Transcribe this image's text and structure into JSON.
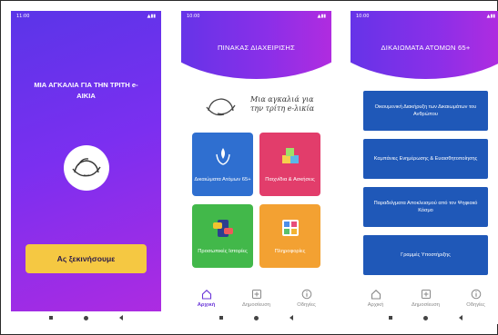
{
  "screen1": {
    "status_time": "11:00",
    "title": "ΜΙΑ ΑΓΚΑΛΙΑ ΓΙΑ ΤΗΝ ΤΡΙΤΗ e-ΑΙΚΙΑ",
    "start_button": "Ας ξεκινήσουμε"
  },
  "screen2": {
    "status_time": "10:00",
    "header_title": "ΠΙΝΑΚΑΣ ΔΙΑΧΕΙΡΙΣΗΣ",
    "logo_text_line1": "Μια αγκαλιά για",
    "logo_text_line2": "την τρίτη e-λικία",
    "tiles": [
      {
        "label": "Δικαιώματα Ατόμων 65+",
        "color": "#2f6fd0"
      },
      {
        "label": "Παιχνίδια & Ασκήσεις",
        "color": "#e23d6b"
      },
      {
        "label": "Προσωπικές Ιστορίες",
        "color": "#42b84a"
      },
      {
        "label": "Πληροφορίες",
        "color": "#f3a132"
      }
    ],
    "nav": [
      {
        "label": "Αρχική",
        "icon": "home-icon"
      },
      {
        "label": "Δημοσίευση",
        "icon": "add-post-icon"
      },
      {
        "label": "Οδηγίες",
        "icon": "info-icon"
      }
    ]
  },
  "screen3": {
    "status_time": "10:00",
    "header_title": "ΔΙΚΑΙΩΜΑΤΑ ΑΤΟΜΩΝ 65+",
    "buttons": [
      "Οικουμενική Διακήρυξη των Δικαιωμάτων του Ανθρώπου",
      "Καμπάνιες Ενημέρωσης & Ευαισθητοποίησης",
      "Παραδείγματα Αποκλεισμού από τον Ψηφιακό Κόσμο",
      "Γραμμές Υποστήριξης"
    ],
    "nav": [
      {
        "label": "Αρχική",
        "icon": "home-icon"
      },
      {
        "label": "Δημοσίευση",
        "icon": "add-post-icon"
      },
      {
        "label": "Οδηγίες",
        "icon": "info-icon"
      }
    ]
  },
  "colors": {
    "purple": "#6a35d8",
    "magenta": "#c02bdc",
    "yellow_button": "#f5c842",
    "list_blue": "#1f58b8"
  }
}
